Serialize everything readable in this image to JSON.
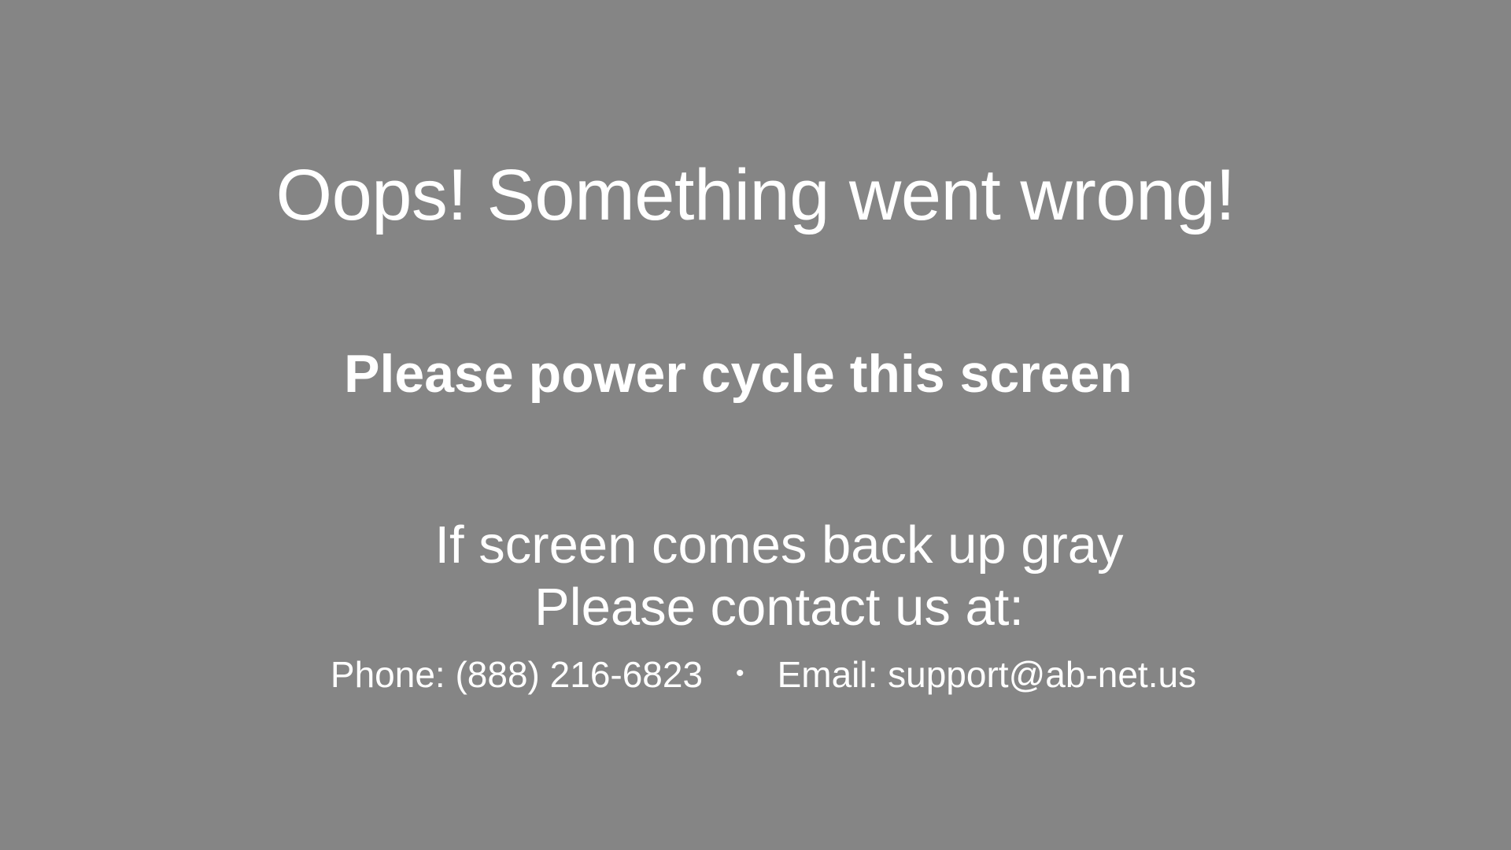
{
  "error_screen": {
    "headline": "Oops! Something went wrong!",
    "instruction": "Please power cycle this screen",
    "message_line1": "If screen comes back up gray",
    "message_line2": "Please contact us at:",
    "phone": "Phone: (888) 216-6823",
    "separator": "•",
    "email": "Email: support@ab-net.us"
  },
  "colors": {
    "background": "#858585",
    "text": "#ffffff"
  }
}
